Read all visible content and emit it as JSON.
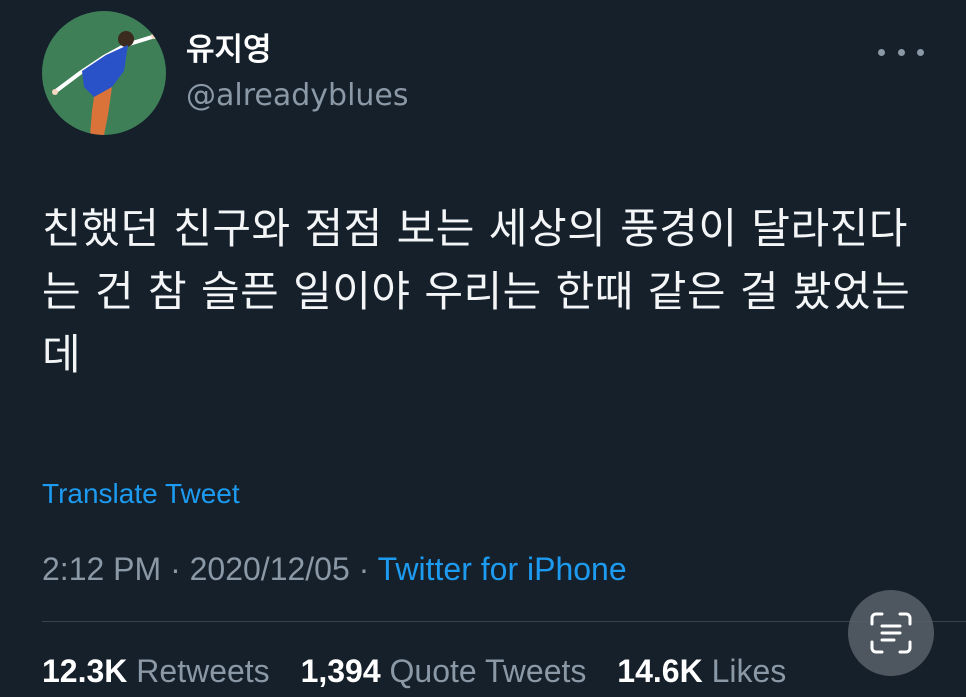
{
  "user": {
    "display_name": "유지영",
    "handle": "@alreadyblues"
  },
  "tweet": {
    "text": "친했던 친구와 점점 보는 세상의 풍경이 달라진다는 건 참 슬픈 일이야 우리는 한때 같은 걸 봤었는데",
    "translate_label": "Translate Tweet",
    "time": "2:12 PM",
    "separator": " · ",
    "date": "2020/12/05",
    "source": "Twitter for iPhone"
  },
  "stats": {
    "retweets": {
      "count": "12.3K",
      "label": "Retweets"
    },
    "quote_tweets": {
      "count": "1,394",
      "label": "Quote Tweets"
    },
    "likes": {
      "count": "14.6K",
      "label": "Likes"
    }
  },
  "icons": {
    "more": "more-horizontal-icon",
    "scan": "text-scan-icon"
  },
  "colors": {
    "background": "#15202b",
    "link": "#1d9bf0",
    "secondary_text": "#8b98a5",
    "avatar_bg": "#3e7f57"
  }
}
